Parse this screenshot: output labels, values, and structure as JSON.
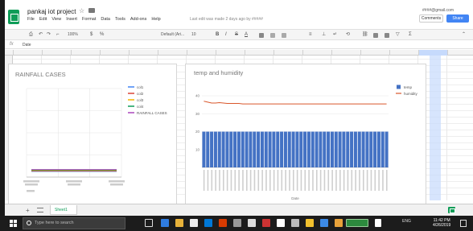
{
  "app": {
    "doc_title": "pankaj iot project",
    "menus": [
      "File",
      "Edit",
      "View",
      "Insert",
      "Format",
      "Data",
      "Tools",
      "Add-ons",
      "Help"
    ],
    "edit_note": "Last edit was made 2 days ago by #####",
    "user_email": "####@gmail.com",
    "comments_label": "Comments",
    "share_label": "Share",
    "zoom": "100%",
    "font_name": "Default (Ari...",
    "font_size": "10",
    "cell_value": "Date",
    "sheet_tab": "Sheet1"
  },
  "chart1": {
    "title": "RAINFALL CASES",
    "legend": [
      "col1",
      "col2",
      "col3",
      "col4",
      "RAINFALL CASES"
    ]
  },
  "chart2": {
    "title": "temp and humidity",
    "legend": [
      "temp",
      "humidity"
    ],
    "xlabel": "Date"
  },
  "chart_data": [
    {
      "type": "line",
      "title": "RAINFALL CASES",
      "series": [
        {
          "name": "col1",
          "values": [
            1,
            1,
            1
          ]
        },
        {
          "name": "col2",
          "values": [
            1,
            1,
            1
          ]
        },
        {
          "name": "col3",
          "values": [
            1,
            1,
            1
          ]
        },
        {
          "name": "col4",
          "values": [
            1,
            1,
            1
          ]
        },
        {
          "name": "RAINFALL CASES",
          "values": [
            1,
            1,
            1
          ]
        }
      ],
      "colors": [
        "#4285f4",
        "#db4437",
        "#f4b400",
        "#0f9d58",
        "#ab47bc"
      ]
    },
    {
      "type": "bar",
      "title": "temp and humidity",
      "yticks": [
        10,
        20,
        30,
        40
      ],
      "ylim": [
        0,
        45
      ],
      "bar_count": 48,
      "series": [
        {
          "name": "temp",
          "values": [
            20,
            20,
            20,
            20,
            20,
            20,
            20,
            20,
            20,
            20,
            20,
            20,
            20,
            20,
            20,
            20,
            20,
            20,
            20,
            20,
            20,
            20,
            20,
            20,
            20,
            20,
            20,
            20,
            20,
            20,
            20,
            20,
            20,
            20,
            20,
            20,
            20,
            20,
            20,
            20,
            20,
            20,
            20,
            20,
            20,
            20,
            20,
            20
          ],
          "color": "#4472c4"
        },
        {
          "name": "humidity",
          "values": [
            37,
            36.5,
            36,
            36,
            36.2,
            36,
            35.8,
            35.8,
            35.8,
            35.8,
            35.5,
            35.5,
            35.5,
            35.5,
            35.5,
            35.5,
            35.5,
            35.5,
            35.5,
            35.5,
            35.5,
            35.5,
            35.5,
            35.5,
            35.5,
            35.5,
            35.5,
            35.5,
            35.5,
            35.5,
            35.5,
            35.5,
            35.5,
            35.5,
            35.5,
            35.5,
            35.5,
            35.5,
            35.5,
            35.5,
            35.5,
            35.5,
            35.5,
            35.5,
            35.5,
            35.5,
            35.5,
            35.5
          ],
          "color": "#d9572b"
        }
      ]
    }
  ],
  "taskbar": {
    "search_placeholder": "Type here to search",
    "tray_text": "ENG",
    "time": "11:42 PM",
    "date": "4/26/2019"
  }
}
